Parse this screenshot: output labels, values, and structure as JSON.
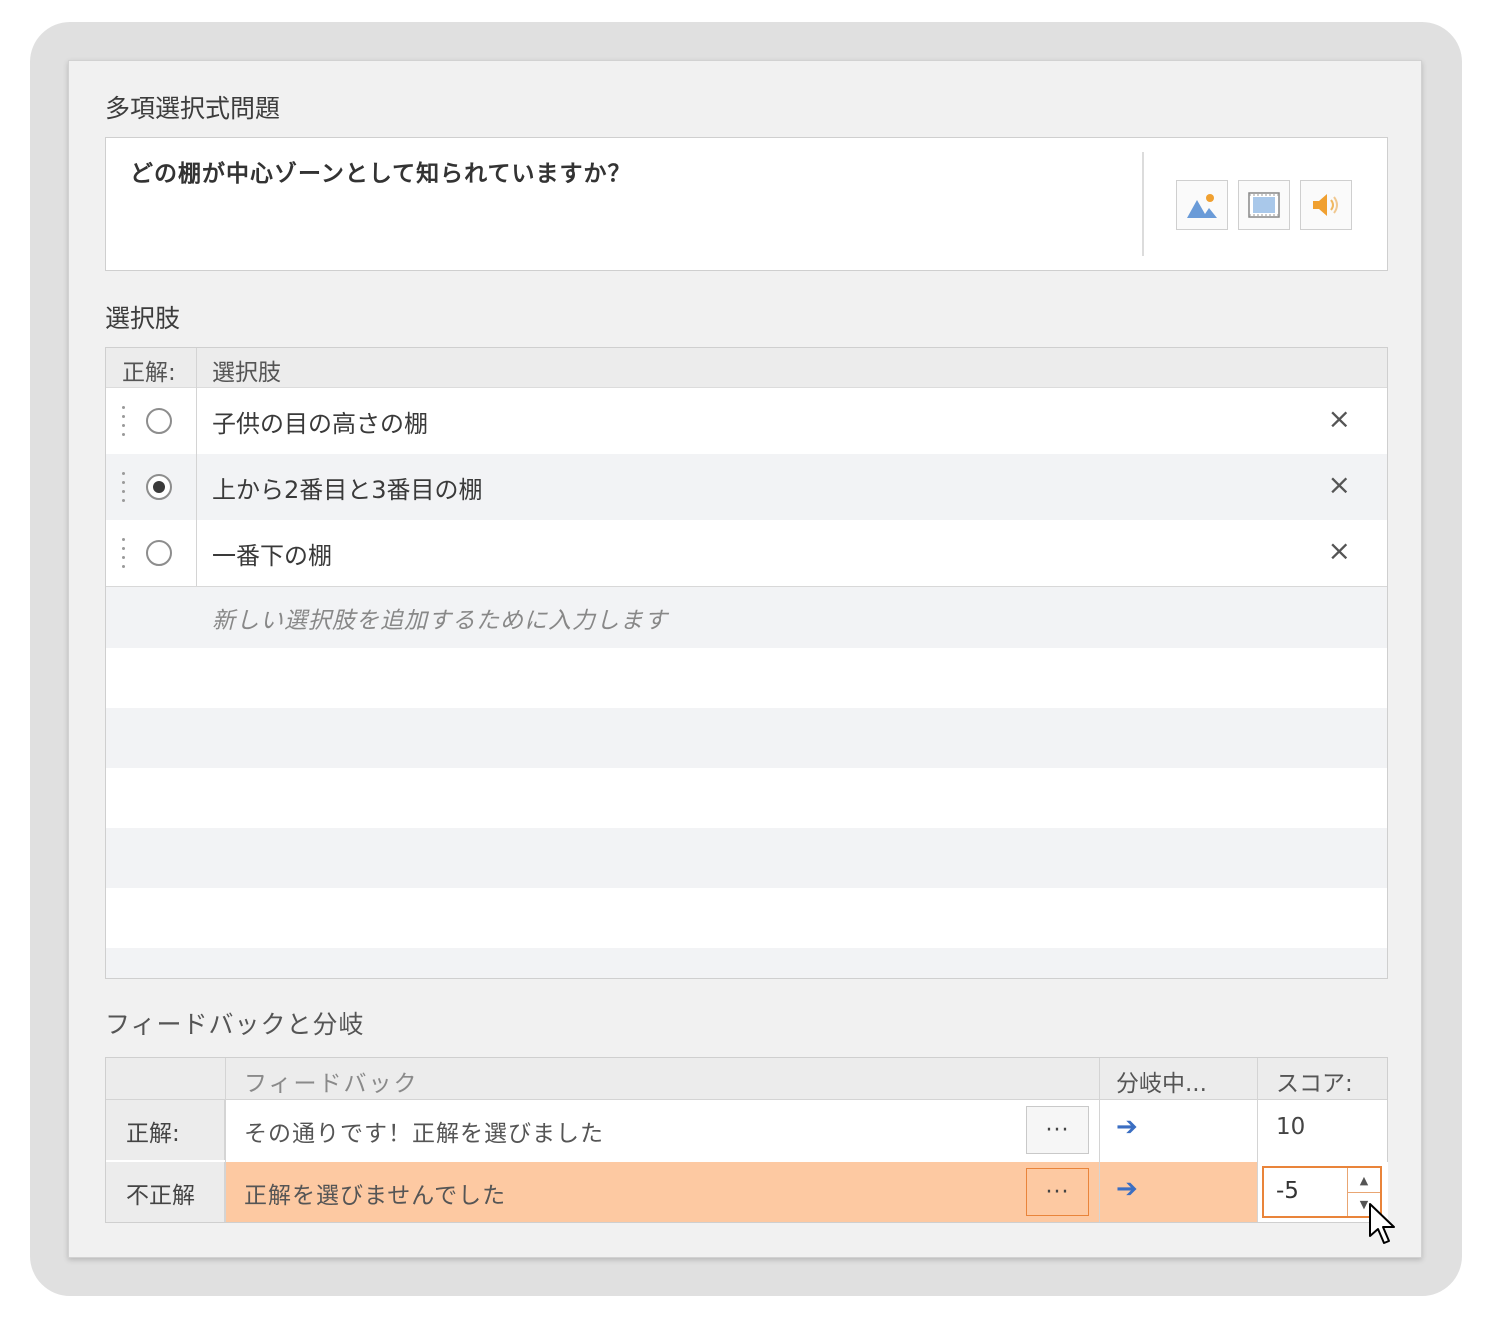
{
  "sections": {
    "question_title": "多項選択式問題",
    "choices_title": "選択肢",
    "feedback_title": "フィードバックと分岐"
  },
  "question": {
    "text": "どの棚が中心ゾーンとして知られていますか？",
    "media_buttons": [
      "image-icon",
      "video-icon",
      "audio-icon"
    ]
  },
  "choices": {
    "header_correct": "正解:",
    "header_choice": "選択肢",
    "items": [
      {
        "label": "子供の目の高さの棚",
        "selected": false
      },
      {
        "label": "上から2番目と3番目の棚",
        "selected": true
      },
      {
        "label": "一番下の棚",
        "selected": false
      }
    ],
    "delete_glyph": "×",
    "add_placeholder": "新しい選択肢を追加するために入力します"
  },
  "feedback": {
    "header_feedback": "フィードバック",
    "header_branch": "分岐中...",
    "header_score": "スコア:",
    "more_label": "···",
    "branch_glyph": "➔",
    "rows": [
      {
        "label": "正解:",
        "text": "その通りです！正解を選びました",
        "score": "10"
      },
      {
        "label": "不正解",
        "text": "正解を選びませんでした",
        "score": "-5"
      }
    ]
  },
  "colors": {
    "selected_row": "#fdc9a2",
    "accent_orange": "#e9843a",
    "arrow_blue": "#3b6ec2"
  }
}
